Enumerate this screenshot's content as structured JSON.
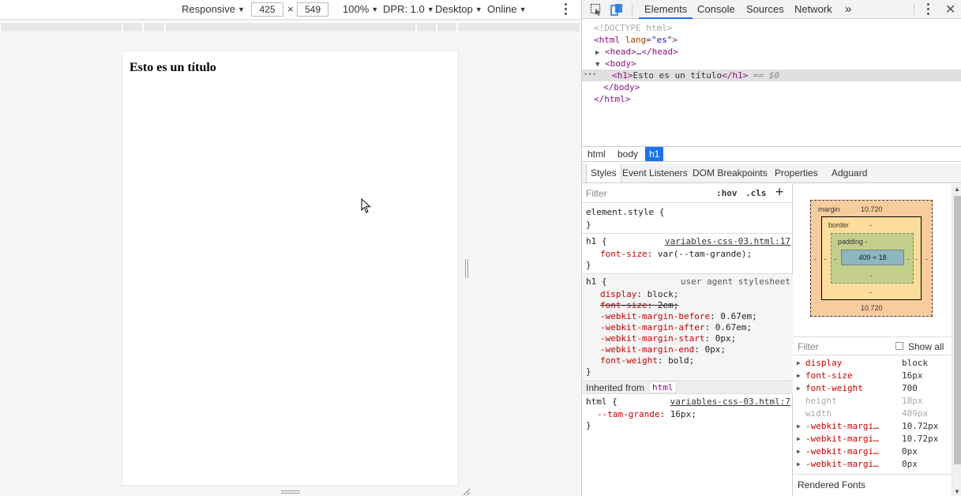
{
  "device_toolbar": {
    "mode": "Responsive",
    "width": "425",
    "times": "×",
    "height": "549",
    "zoom": "100%",
    "dpr": "DPR: 1.0",
    "device_type": "Desktop",
    "throttling": "Online"
  },
  "page": {
    "heading": "Esto es un título"
  },
  "devtools": {
    "tabs": [
      "Elements",
      "Console",
      "Sources",
      "Network"
    ],
    "more_tabs": "»",
    "dom": {
      "doctype": "<!DOCTYPE html>",
      "html_open_tag": "<html",
      "html_attr_name": "lang",
      "html_attr_value": "\"es\"",
      "html_open_end": ">",
      "head_open": "<head>",
      "head_ellipsis": "…",
      "head_close": "</head>",
      "body_open": "<body>",
      "h1_open": "<h1>",
      "h1_text": "Esto es un título",
      "h1_close": "</h1>",
      "selected_marker": "== $0",
      "dots": "•••",
      "body_close": "</body>",
      "html_close": "</html>"
    },
    "breadcrumbs": [
      "html",
      "body",
      "h1"
    ],
    "subtabs": [
      "Styles",
      "Event Listeners",
      "DOM Breakpoints",
      "Properties",
      "Adguard"
    ],
    "styles": {
      "filter_placeholder": "Filter",
      "hov": ":hov",
      "cls": ".cls",
      "plus": "+",
      "element_style": "element.style {",
      "close_brace": "}",
      "rule1_selector": "h1 {",
      "rule1_source": "variables-css-03.html:17",
      "rule1_prop": "font-size",
      "rule1_value": "var(--tam-grande);",
      "rule2_selector": "h1 {",
      "rule2_source": "user agent stylesheet",
      "rule2_props": [
        {
          "name": "display",
          "value": "block;"
        },
        {
          "name": "font-size",
          "value": "2em;"
        },
        {
          "name": "-webkit-margin-before",
          "value": "0.67em;"
        },
        {
          "name": "-webkit-margin-after",
          "value": "0.67em;"
        },
        {
          "name": "-webkit-margin-start",
          "value": "0px;"
        },
        {
          "name": "-webkit-margin-end",
          "value": "0px;"
        },
        {
          "name": "font-weight",
          "value": "bold;"
        }
      ],
      "inherited_label": "Inherited from",
      "inherited_tag": "html",
      "rule3_selector": "html {",
      "rule3_source": "variables-css-03.html:7",
      "rule3_prop": "--tam-grande",
      "rule3_value": "16px;"
    },
    "box_model": {
      "margin_label": "margin",
      "margin_top": "10.720",
      "margin_bottom": "10.720",
      "margin_left": "-",
      "margin_right": "-",
      "border_label": "border",
      "border_top": "-",
      "border_bottom": "-",
      "border_left": "-",
      "border_right": "-",
      "padding_label": "padding -",
      "padding_bottom": "-",
      "padding_left": "-",
      "padding_right": "-",
      "content": "409 × 18"
    },
    "computed": {
      "filter_placeholder": "Filter",
      "show_all": "Show all",
      "rows": [
        {
          "name": "display",
          "value": "block"
        },
        {
          "name": "font-size",
          "value": "16px"
        },
        {
          "name": "font-weight",
          "value": "700"
        },
        {
          "name": "height",
          "value": "18px"
        },
        {
          "name": "width",
          "value": "409px"
        },
        {
          "name": "-webkit-margi…",
          "value": "10.72px"
        },
        {
          "name": "-webkit-margi…",
          "value": "10.72px"
        },
        {
          "name": "-webkit-margi…",
          "value": "0px"
        },
        {
          "name": "-webkit-margi…",
          "value": "0px"
        }
      ],
      "rendered_fonts": "Rendered Fonts"
    }
  }
}
